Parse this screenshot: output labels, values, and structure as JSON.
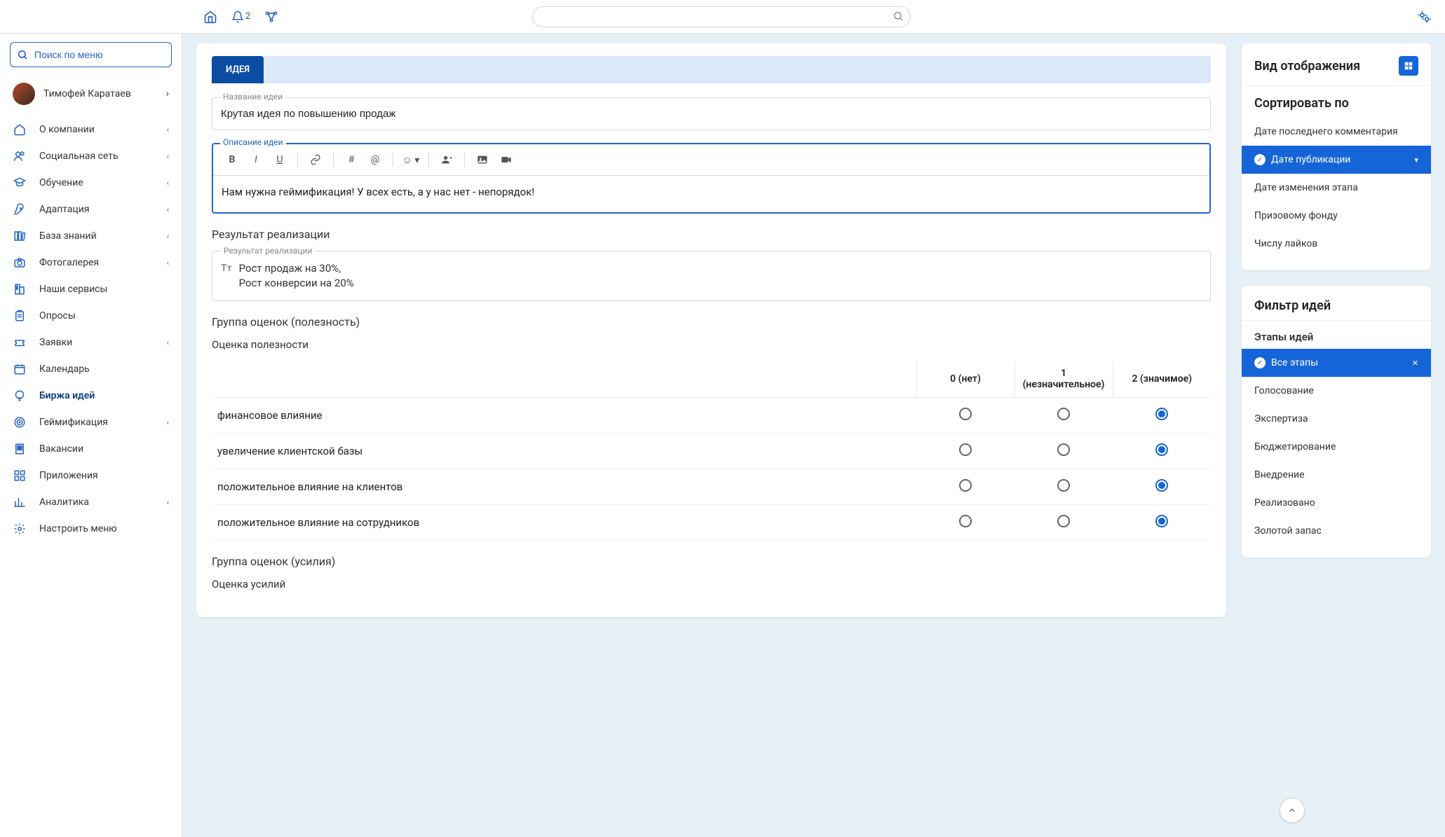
{
  "topbar": {
    "notif_count": "2"
  },
  "menu_search_placeholder": "Поиск по меню",
  "user": {
    "name": "Тимофей Каратаев"
  },
  "nav": [
    {
      "label": "О компании",
      "icon": "home",
      "expandable": true
    },
    {
      "label": "Социальная сеть",
      "icon": "users",
      "expandable": true
    },
    {
      "label": "Обучение",
      "icon": "grad",
      "expandable": true
    },
    {
      "label": "Адаптация",
      "icon": "rocket",
      "expandable": true
    },
    {
      "label": "База знаний",
      "icon": "books",
      "expandable": true
    },
    {
      "label": "Фотогалерея",
      "icon": "camera",
      "expandable": true
    },
    {
      "label": "Наши сервисы",
      "icon": "building",
      "expandable": false
    },
    {
      "label": "Опросы",
      "icon": "clipboard",
      "expandable": false
    },
    {
      "label": "Заявки",
      "icon": "ticket",
      "expandable": true
    },
    {
      "label": "Календарь",
      "icon": "calendar",
      "expandable": false
    },
    {
      "label": "Биржа идей",
      "icon": "bulb",
      "expandable": false,
      "active": true
    },
    {
      "label": "Геймификация",
      "icon": "target",
      "expandable": true
    },
    {
      "label": "Вакансии",
      "icon": "office",
      "expandable": false
    },
    {
      "label": "Приложения",
      "icon": "apps",
      "expandable": false
    },
    {
      "label": "Аналитика",
      "icon": "chart",
      "expandable": true
    },
    {
      "label": "Настроить меню",
      "icon": "gear",
      "expandable": false
    }
  ],
  "form": {
    "tab": "ИДЕЯ",
    "name_label": "Название идеи",
    "name_value": "Крутая идея по повышению продаж",
    "desc_label": "Описание идеи",
    "desc_value": "Нам нужна геймификация! У всех есть, а у нас нет - непорядок!",
    "result_title": "Результат реализации",
    "result_label": "Результат реализации",
    "result_line1": "Рост продаж на 30%,",
    "result_line2": "Рост конверсии на 20%",
    "group_usefulness": "Группа оценок (полезность)",
    "rating_usefulness": "Оценка полезности",
    "col0": "0 (нет)",
    "col1": "1 (незначительное)",
    "col2": "2 (значимое)",
    "rows": [
      {
        "label": "финансовое влияние",
        "value": 2
      },
      {
        "label": "увеличение клиентской базы",
        "value": 2
      },
      {
        "label": "положительное влияние на клиентов",
        "value": 2
      },
      {
        "label": "положительное влияние на сотрудников",
        "value": 2
      }
    ],
    "group_effort": "Группа оценок (усилия)",
    "rating_effort": "Оценка усилий"
  },
  "right": {
    "display_mode": "Вид отображения",
    "sort_by": "Сортировать по",
    "sort_options": [
      {
        "label": "Дате последнего комментария",
        "active": false
      },
      {
        "label": "Дате публикации",
        "active": true
      },
      {
        "label": "Дате изменения этапа",
        "active": false
      },
      {
        "label": "Призовому фонду",
        "active": false
      },
      {
        "label": "Числу лайков",
        "active": false
      }
    ],
    "filter_title": "Фильтр идей",
    "stages_title": "Этапы идей",
    "stages": [
      {
        "label": "Все этапы",
        "active": true
      },
      {
        "label": "Голосование"
      },
      {
        "label": "Экспертиза"
      },
      {
        "label": "Бюджетирование"
      },
      {
        "label": "Внедрение"
      },
      {
        "label": "Реализовано"
      },
      {
        "label": "Золотой запас"
      }
    ]
  }
}
